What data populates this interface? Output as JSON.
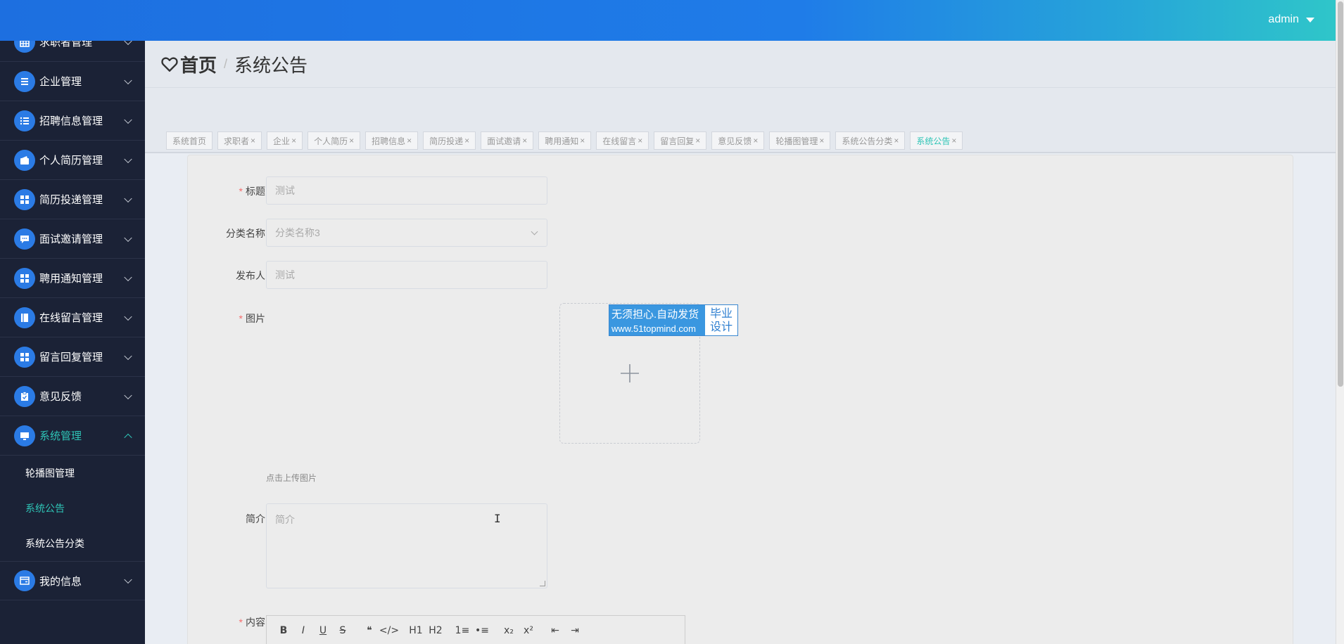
{
  "header": {
    "user": "admin"
  },
  "sidebar": {
    "items": [
      {
        "label": "求职者管理",
        "icon": "grid-icon"
      },
      {
        "label": "企业管理",
        "icon": "list-icon"
      },
      {
        "label": "招聘信息管理",
        "icon": "list-icon"
      },
      {
        "label": "个人简历管理",
        "icon": "wallet-icon"
      },
      {
        "label": "简历投递管理",
        "icon": "apps-icon"
      },
      {
        "label": "面试邀请管理",
        "icon": "chat-icon"
      },
      {
        "label": "聘用通知管理",
        "icon": "apps-icon"
      },
      {
        "label": "在线留言管理",
        "icon": "book-icon"
      },
      {
        "label": "留言回复管理",
        "icon": "apps-icon"
      },
      {
        "label": "意见反馈",
        "icon": "clipboard-icon"
      },
      {
        "label": "系统管理",
        "icon": "monitor-icon",
        "expanded": true
      },
      {
        "label": "我的信息",
        "icon": "card-icon"
      }
    ],
    "submenu": [
      {
        "label": "轮播图管理"
      },
      {
        "label": "系统公告",
        "active": true
      },
      {
        "label": "系统公告分类"
      }
    ]
  },
  "breadcrumb": {
    "home": "首页",
    "separator": "/",
    "current": "系统公告"
  },
  "tags": [
    {
      "label": "系统首页",
      "closable": false
    },
    {
      "label": "求职者",
      "closable": true
    },
    {
      "label": "企业",
      "closable": true
    },
    {
      "label": "个人简历",
      "closable": true
    },
    {
      "label": "招聘信息",
      "closable": true
    },
    {
      "label": "简历投递",
      "closable": true
    },
    {
      "label": "面试邀请",
      "closable": true
    },
    {
      "label": "聘用通知",
      "closable": true
    },
    {
      "label": "在线留言",
      "closable": true
    },
    {
      "label": "留言回复",
      "closable": true
    },
    {
      "label": "意见反馈",
      "closable": true
    },
    {
      "label": "轮播图管理",
      "closable": true
    },
    {
      "label": "系统公告分类",
      "closable": true
    },
    {
      "label": "系统公告",
      "closable": true,
      "active": true
    }
  ],
  "form": {
    "title": {
      "label": "标题",
      "required": true,
      "placeholder": "测试"
    },
    "category": {
      "label": "分类名称",
      "placeholder": "分类名称3"
    },
    "publisher": {
      "label": "发布人",
      "placeholder": "测试"
    },
    "image": {
      "label": "图片",
      "required": true,
      "hint": "点击上传图片"
    },
    "summary": {
      "label": "简介",
      "placeholder": "简介"
    },
    "content": {
      "label": "内容",
      "required": true
    }
  },
  "watermark": {
    "line1": "无须担心.自动发货",
    "url": "www.51topmind.com",
    "right1": "毕业",
    "right2": "设计"
  },
  "editor_toolbar": [
    "B",
    "I",
    "U",
    "S",
    "❝",
    "</>",
    "H1",
    "H2",
    "1≡",
    "•≡",
    "x₂",
    "x²",
    "⇤",
    "⇥"
  ],
  "colors": {
    "accent": "#2ec4b6",
    "sidebar_bg": "#1b2236",
    "icon_bg": "#2b7be5",
    "required": "#f56c6c"
  }
}
